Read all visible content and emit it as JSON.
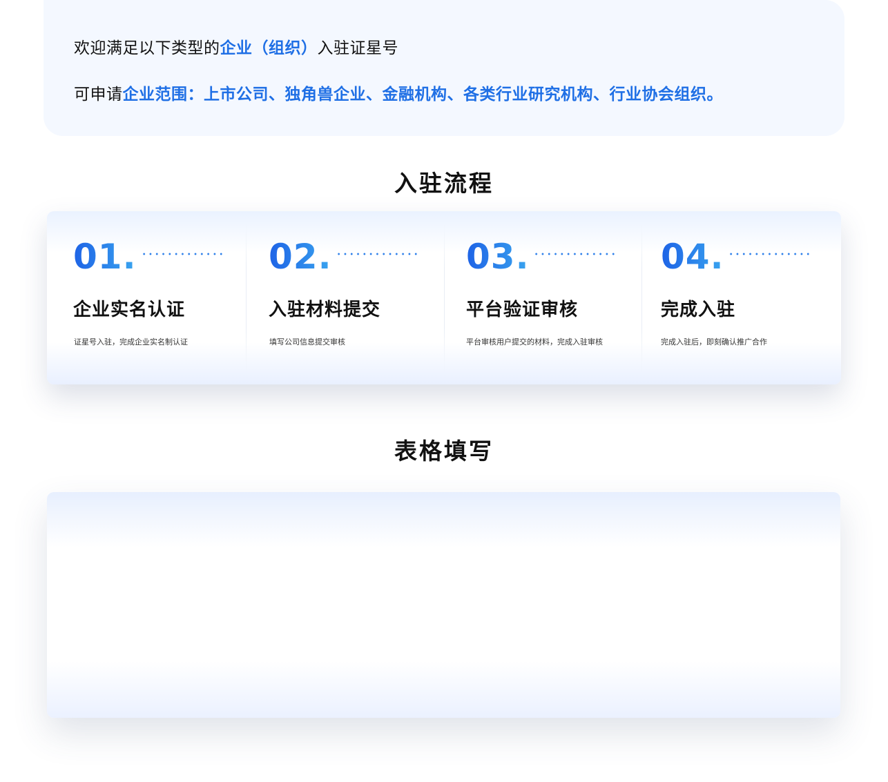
{
  "intro": {
    "line1_prefix": "欢迎满足以下类型的",
    "line1_highlight": "企业（组织）",
    "line1_suffix": "入驻证星号",
    "line2_prefix": "可申请",
    "line2_highlight": "企业范围：上市公司、独角兽企业、金融机构、各类行业研究机构、行业协会组织。"
  },
  "process": {
    "title": "入驻流程",
    "steps": [
      {
        "number": "01.",
        "title": "企业实名认证",
        "desc": "证星号入驻，完成企业实名制认证"
      },
      {
        "number": "02.",
        "title": "入驻材料提交",
        "desc": "填写公司信息提交审核"
      },
      {
        "number": "03.",
        "title": "平台验证审核",
        "desc": "平台审核用户提交的材料，完成入驻审核"
      },
      {
        "number": "04.",
        "title": "完成入驻",
        "desc": "完成入驻后，即刻确认推广合作"
      }
    ]
  },
  "form": {
    "title": "表格填写"
  },
  "colors": {
    "accent": "#1f6fe5",
    "intro_bg": "#f4f8ff",
    "text": "#111111"
  }
}
